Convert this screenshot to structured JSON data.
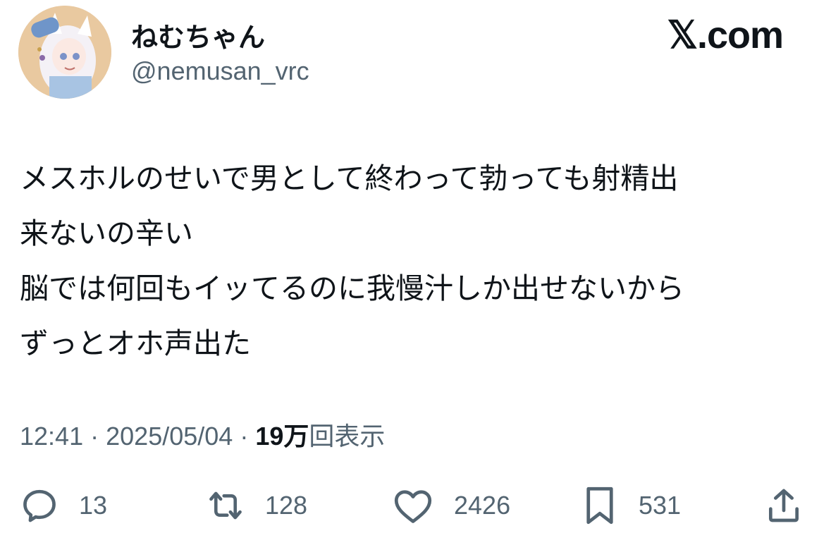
{
  "author": {
    "display_name": "ねむちゃん",
    "handle": "@nemusan_vrc"
  },
  "brand": "𝕏.com",
  "tweet": {
    "lines": [
      "メスホルのせいで男として終わって勃っても射精出",
      "来ないの辛い",
      "脳では何回もイッてるのに我慢汁しか出せないから",
      "ずっとオホ声出た"
    ]
  },
  "meta": {
    "time": "12:41",
    "separator": "·",
    "date": "2025/05/04",
    "views_count": "19万",
    "views_label": "回表示"
  },
  "actions": {
    "reply": {
      "icon": "reply-icon",
      "count": "13"
    },
    "retweet": {
      "icon": "retweet-icon",
      "count": "128"
    },
    "like": {
      "icon": "heart-icon",
      "count": "2426"
    },
    "bookmark": {
      "icon": "bookmark-icon",
      "count": "531"
    },
    "share": {
      "icon": "share-icon"
    }
  },
  "colors": {
    "text_primary": "#0f1419",
    "text_secondary": "#536471"
  }
}
